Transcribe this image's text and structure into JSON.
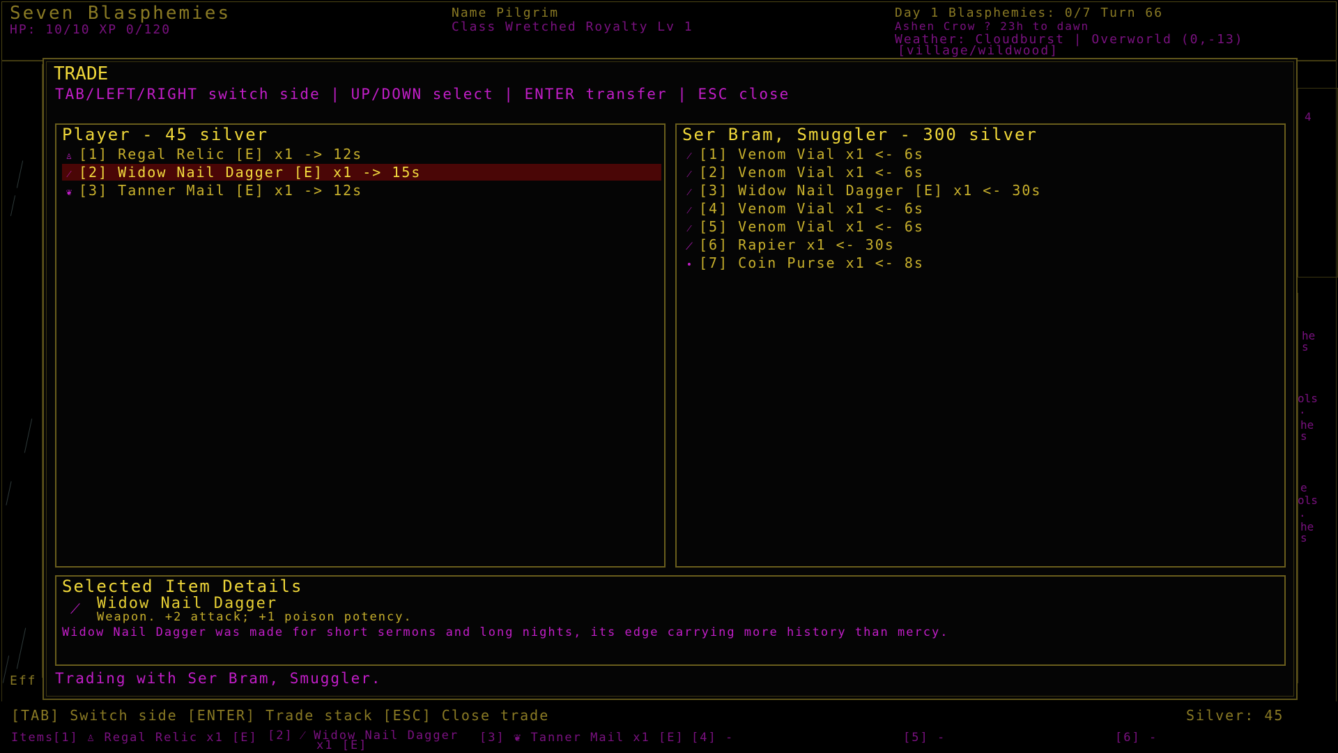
{
  "hud": {
    "title": "Seven Blasphemies",
    "stats": "HP: 10/10 XP 0/120",
    "name": "Name Pilgrim",
    "class": "Class Wretched Royalty Lv 1",
    "day": "Day 1 Blasphemies: 0/7 Turn 66",
    "omen": "Ashen Crow ? 23h to dawn",
    "weather": "Weather: Cloudburst | Overworld (0,-13)",
    "location": "[village/wildwood]"
  },
  "background": {
    "right_fragments": [
      "4",
      "he",
      "s",
      "ols",
      ".",
      "he",
      "s",
      "e",
      "ols",
      ".",
      "he",
      "s"
    ],
    "left_fragment": "Eff"
  },
  "trade": {
    "title": "TRADE",
    "help": "TAB/LEFT/RIGHT switch side | UP/DOWN select | ENTER transfer | ESC close",
    "player": {
      "title": "Player - 45 silver",
      "items": [
        {
          "icon": "relic-icon",
          "glyph": "♙",
          "label": "[1] Regal Relic [E] x1 -> 12s",
          "selected": false
        },
        {
          "icon": "dagger-icon",
          "glyph": "⁄",
          "label": "[2] Widow Nail Dagger [E] x1 -> 15s",
          "selected": true
        },
        {
          "icon": "armor-icon",
          "glyph": "❦",
          "label": "[3] Tanner Mail [E] x1 -> 12s",
          "selected": false
        }
      ]
    },
    "merchant": {
      "title": "Ser Bram, Smuggler - 300 silver",
      "items": [
        {
          "icon": "vial-icon",
          "glyph": "⁄",
          "label": "[1] Venom Vial x1 <- 6s"
        },
        {
          "icon": "vial-icon",
          "glyph": "⁄",
          "label": "[2] Venom Vial x1 <- 6s"
        },
        {
          "icon": "dagger-icon",
          "glyph": "⁄",
          "label": "[3] Widow Nail Dagger [E] x1 <- 30s"
        },
        {
          "icon": "vial-icon",
          "glyph": "⁄",
          "label": "[4] Venom Vial x1 <- 6s"
        },
        {
          "icon": "vial-icon",
          "glyph": "⁄",
          "label": "[5] Venom Vial x1 <- 6s"
        },
        {
          "icon": "sword-icon",
          "glyph": "⟋",
          "label": "[6] Rapier x1 <- 30s"
        },
        {
          "icon": "coin-purse-icon",
          "glyph": "•",
          "label": "[7] Coin Purse x1 <- 8s"
        }
      ]
    },
    "details": {
      "title": "Selected Item Details",
      "icon": "dagger-icon",
      "name": "Widow Nail Dagger",
      "stats": "Weapon. +2 attack; +1 poison potency.",
      "lore": "Widow Nail Dagger was made for short sermons and long nights, its edge carrying more history than mercy."
    },
    "status": "Trading with Ser Bram, Smuggler."
  },
  "footer": {
    "controls": "[TAB] Switch side [ENTER] Trade stack [ESC] Close trade",
    "silver": "Silver: 45",
    "items_label": "Items",
    "slots": [
      {
        "key": "[1]",
        "glyph": "♙",
        "icon": "relic-icon",
        "label": "Regal Relic x1 [E]"
      },
      {
        "key": "[2]",
        "glyph": "⁄",
        "icon": "dagger-icon",
        "label": "Widow Nail Dagger",
        "label2": "x1 [E]"
      },
      {
        "key": "[3]",
        "glyph": "❦",
        "icon": "armor-icon",
        "label": "Tanner Mail x1 [E]"
      },
      {
        "key": "[4]",
        "label": "-"
      },
      {
        "key": "[5]",
        "label": "-"
      },
      {
        "key": "[6]",
        "label": "-"
      }
    ]
  },
  "colors": {
    "accent_yellow": "#e6cf34",
    "accent_magenta": "#c21ec8",
    "selection": "#4a0606",
    "border": "#6a5e1c"
  }
}
